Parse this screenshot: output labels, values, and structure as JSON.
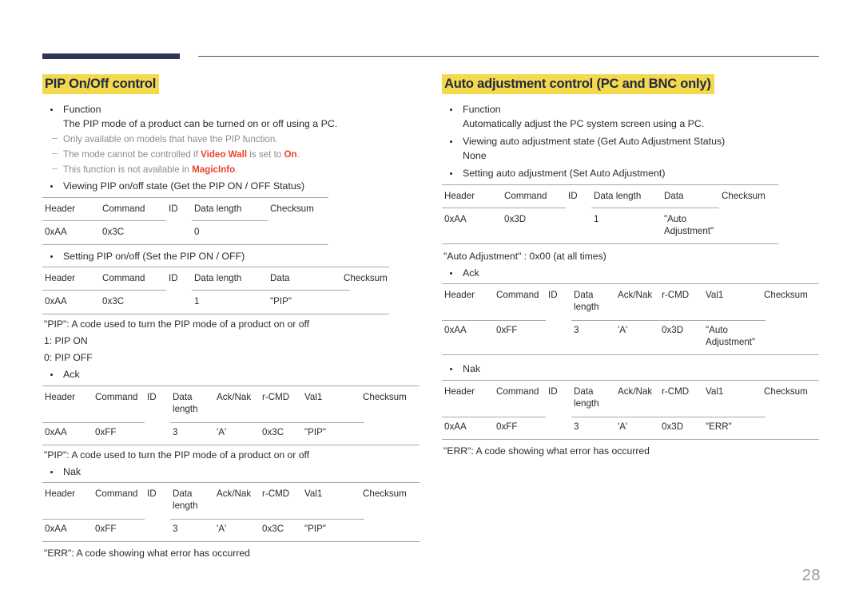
{
  "page": {
    "number": "28"
  },
  "colors": {
    "highlight": "#f2d94e",
    "heading_text": "#23293f",
    "accent_red": "#e8452c",
    "rule_navy": "#2e3654",
    "table_rule": "#a9a9a9",
    "note_gray": "#8c8c8c",
    "page_number": "#9a9a9a"
  },
  "left": {
    "title": "PIP On/Off control",
    "function_label": "Function",
    "function_desc": "The PIP mode of a product can be turned on or off using a PC.",
    "notes": [
      {
        "pre": "Only available on models that have the PIP function.",
        "parts": null
      },
      {
        "pre": "The mode cannot be controlled if ",
        "mid": "Video Wall",
        "post": " is set to ",
        "mid2": "On",
        "post2": "."
      },
      {
        "pre": "This function is not available in ",
        "mid": "MagicInfo",
        "post": "."
      }
    ],
    "note_0_text": "Only available on models that have the PIP function.",
    "view_bullet": "Viewing PIP on/off state (Get the PIP ON / OFF Status)",
    "view_table": {
      "headers": [
        "Header",
        "Command",
        "ID",
        "Data length",
        "Checksum"
      ],
      "row": [
        "0xAA",
        "0x3C",
        "",
        "0",
        ""
      ]
    },
    "set_bullet": "Setting PIP on/off (Set the PIP ON / OFF)",
    "set_table": {
      "headers": [
        "Header",
        "Command",
        "ID",
        "Data length",
        "Data",
        "Checksum"
      ],
      "row": [
        "0xAA",
        "0x3C",
        "",
        "1",
        "\"PIP\"",
        ""
      ]
    },
    "pip_note": "\"PIP\": A code used to turn the PIP mode of a product on or off",
    "pip_on": "1: PIP ON",
    "pip_off": "0: PIP OFF",
    "ack_label": "Ack",
    "ack_table": {
      "headers": [
        "Header",
        "Command",
        "ID",
        "Data length",
        "Ack/Nak",
        "r-CMD",
        "Val1",
        "Checksum"
      ],
      "row": [
        "0xAA",
        "0xFF",
        "",
        "3",
        "'A'",
        "0x3C",
        "\"PIP\"",
        ""
      ]
    },
    "pip_note2": "\"PIP\": A code used to turn the PIP mode of a product on or off",
    "nak_label": "Nak",
    "nak_table": {
      "headers": [
        "Header",
        "Command",
        "ID",
        "Data length",
        "Ack/Nak",
        "r-CMD",
        "Val1",
        "Checksum"
      ],
      "row": [
        "0xAA",
        "0xFF",
        "",
        "3",
        "'A'",
        "0x3C",
        "\"PIP\"",
        ""
      ]
    },
    "err_note": "\"ERR\": A code showing what error has occurred"
  },
  "right": {
    "title": "Auto adjustment control (PC and BNC only)",
    "function_label": "Function",
    "function_desc": "Automatically adjust the PC system screen using a PC.",
    "view_bullet": "Viewing auto adjustment state (Get Auto Adjustment Status)",
    "view_value": "None",
    "set_bullet": "Setting auto adjustment (Set Auto Adjustment)",
    "set_table": {
      "headers": [
        "Header",
        "Command",
        "ID",
        "Data length",
        "Data",
        "Checksum"
      ],
      "row": [
        "0xAA",
        "0x3D",
        "",
        "1",
        "\"Auto Adjustment\"",
        ""
      ]
    },
    "auto_note": "\"Auto Adjustment\" : 0x00 (at all times)",
    "ack_label": "Ack",
    "ack_table": {
      "headers": [
        "Header",
        "Command",
        "ID",
        "Data length",
        "Ack/Nak",
        "r-CMD",
        "Val1",
        "Checksum"
      ],
      "row": [
        "0xAA",
        "0xFF",
        "",
        "3",
        "'A'",
        "0x3D",
        "\"Auto Adjustment\"",
        ""
      ]
    },
    "nak_label": "Nak",
    "nak_table": {
      "headers": [
        "Header",
        "Command",
        "ID",
        "Data length",
        "Ack/Nak",
        "r-CMD",
        "Val1",
        "Checksum"
      ],
      "row": [
        "0xAA",
        "0xFF",
        "",
        "3",
        "'A'",
        "0x3D",
        "\"ERR\"",
        ""
      ]
    },
    "err_note": "\"ERR\": A code showing what error has occurred"
  }
}
